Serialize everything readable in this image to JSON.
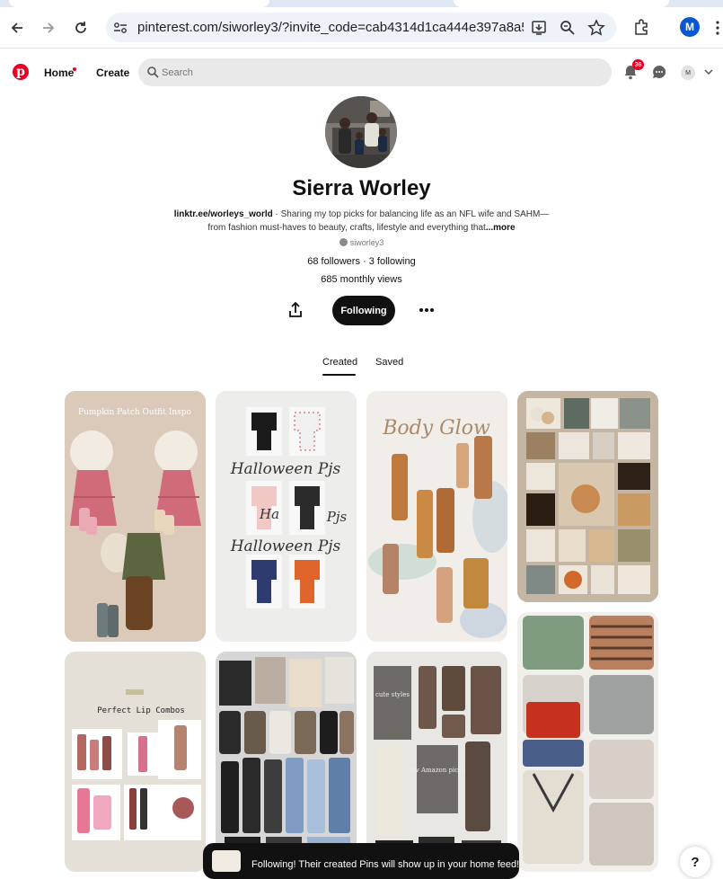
{
  "browser": {
    "url": "pinterest.com/siworley3/?invite_code=cab4314d1ca444e397a8a5d...",
    "profile_initial": "M"
  },
  "header": {
    "home_label": "Home",
    "create_label": "Create",
    "search_placeholder": "Search",
    "notification_count": "36",
    "avatar_initial": "M",
    "logo_letter": "p"
  },
  "profile": {
    "name": "Sierra Worley",
    "bio_link": "linktr.ee/worleys_world",
    "bio_text_1": " · Sharing my top picks for balancing life as an NFL wife and SAHM—",
    "bio_text_2": "from fashion must-haves to beauty, crafts, lifestyle and everything that",
    "bio_more": "...more",
    "handle": "siworley3",
    "stats": "68 followers · 3 following",
    "monthly_views": "685 monthly views",
    "follow_button": "Following"
  },
  "tabs": {
    "created": "Created",
    "saved": "Saved"
  },
  "pins": {
    "pin1_title": "Pumpkin Patch Outfit Inspo",
    "pin2_text": "Halloween Pjs",
    "pin3_title": "Body Glow",
    "pin5_title": "Perfect Lip Combos",
    "pin7_label1": "cute styles",
    "pin7_label2": "fav Amazon picks"
  },
  "toast": {
    "message": "Following! Their created Pins will show up in your home feed!"
  },
  "help": "?",
  "colors": {
    "pinterest_red": "#e60023",
    "chrome_blue": "#0b57d0"
  }
}
